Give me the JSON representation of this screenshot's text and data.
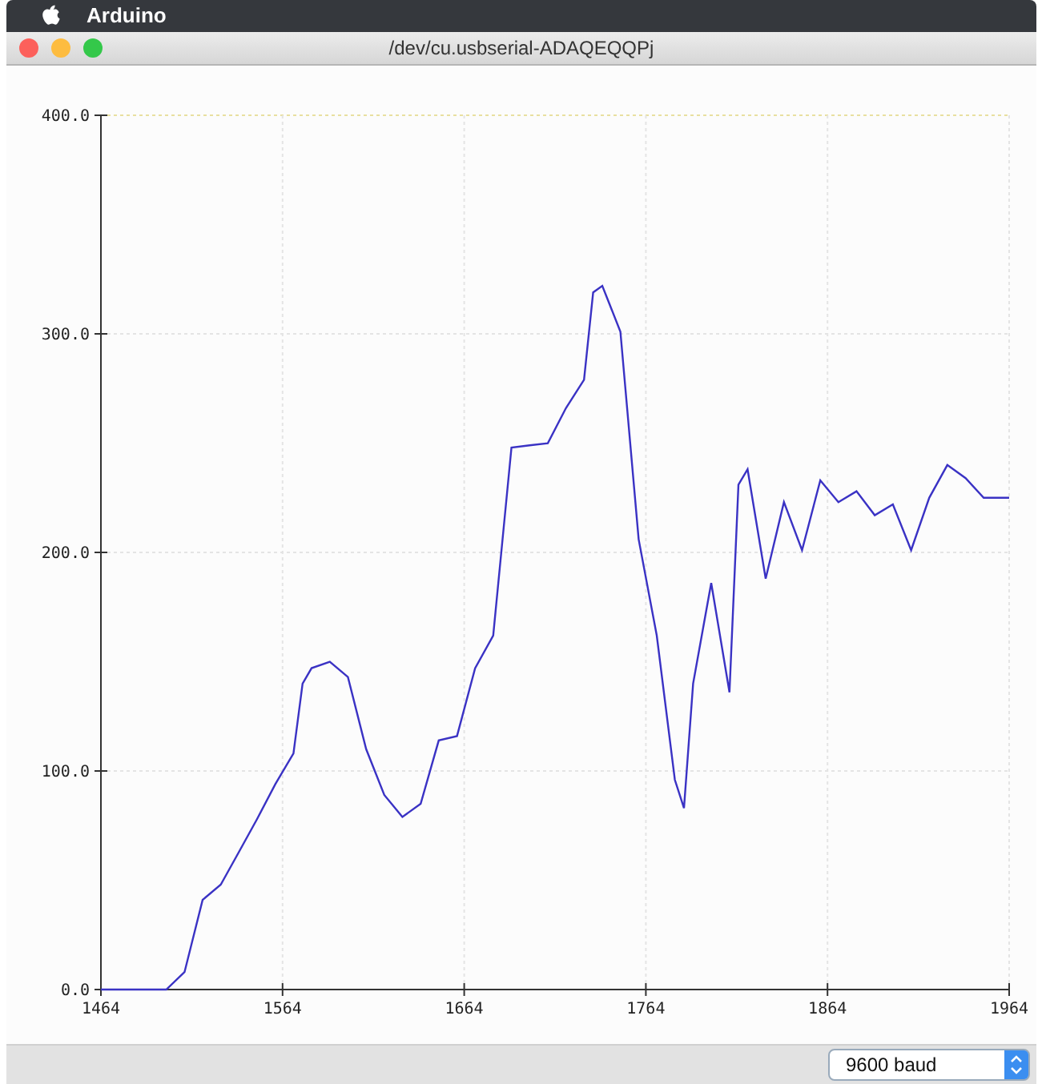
{
  "menu_bar": {
    "app_name": "Arduino"
  },
  "window": {
    "title": "/dev/cu.usbserial-ADAQEQQPj"
  },
  "plot": {
    "chart_data": {
      "type": "line",
      "x": [
        1464,
        1480,
        1500,
        1510,
        1520,
        1530,
        1540,
        1550,
        1560,
        1570,
        1575,
        1580,
        1590,
        1600,
        1610,
        1620,
        1630,
        1640,
        1650,
        1660,
        1670,
        1680,
        1690,
        1700,
        1710,
        1720,
        1730,
        1735,
        1740,
        1750,
        1760,
        1770,
        1780,
        1785,
        1790,
        1800,
        1810,
        1815,
        1820,
        1830,
        1840,
        1850,
        1860,
        1870,
        1880,
        1890,
        1900,
        1910,
        1920,
        1930,
        1940,
        1950,
        1960,
        1964
      ],
      "grid": true,
      "series": [
        {
          "color": "#3a32c4",
          "values": [
            0,
            0,
            0,
            8,
            41,
            48,
            63,
            78,
            94,
            108,
            140,
            147,
            150,
            143,
            110,
            89,
            79,
            85,
            114,
            116,
            147,
            162,
            248,
            249,
            250,
            266,
            279,
            319,
            322,
            301,
            206,
            162,
            96,
            83,
            140,
            186,
            136,
            231,
            238,
            188,
            223,
            201,
            233,
            223,
            228,
            217,
            222,
            201,
            225,
            240,
            234,
            225,
            225,
            225
          ]
        }
      ],
      "xlim": [
        1464,
        1964
      ],
      "ylim": [
        0,
        400
      ],
      "xticks": [
        1464,
        1564,
        1664,
        1764,
        1864,
        1964
      ],
      "yticks": [
        {
          "value": 0,
          "label": "0.0"
        },
        {
          "value": 100,
          "label": "100.0"
        },
        {
          "value": 200,
          "label": "200.0"
        },
        {
          "value": 300,
          "label": "300.0"
        },
        {
          "value": 400,
          "label": "400.0"
        }
      ]
    }
  },
  "bottom_bar": {
    "baud_select": {
      "value": "9600 baud"
    }
  }
}
